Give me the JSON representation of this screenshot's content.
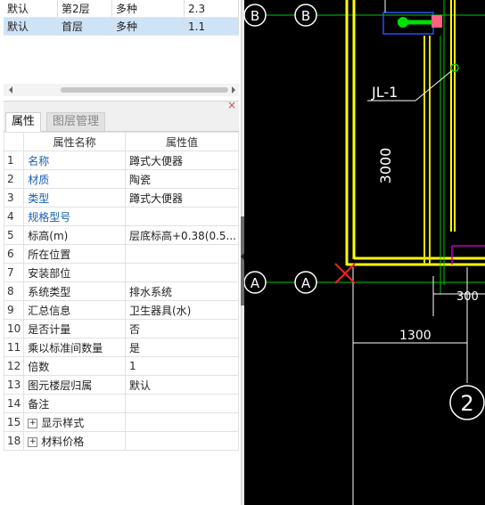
{
  "floors": [
    {
      "cells": [
        "默认",
        "第2层",
        "多种",
        "2.3"
      ],
      "selected": false
    },
    {
      "cells": [
        "默认",
        "首层",
        "多种",
        "1.1"
      ],
      "selected": true
    }
  ],
  "tabs": {
    "properties": "属性",
    "layers": "图层管理"
  },
  "props": {
    "header_name": "属性名称",
    "header_value": "属性值",
    "rows": [
      {
        "num": "1",
        "name": "名称",
        "value": "蹲式大便器",
        "blue": true
      },
      {
        "num": "2",
        "name": "材质",
        "value": "陶瓷",
        "blue": true
      },
      {
        "num": "3",
        "name": "类型",
        "value": "蹲式大便器",
        "blue": true
      },
      {
        "num": "4",
        "name": "规格型号",
        "value": "",
        "blue": true
      },
      {
        "num": "5",
        "name": "标高(m)",
        "value": "层底标高+0.38(0.5...",
        "blue": false
      },
      {
        "num": "6",
        "name": "所在位置",
        "value": "",
        "blue": false
      },
      {
        "num": "7",
        "name": "安装部位",
        "value": "",
        "blue": false
      },
      {
        "num": "8",
        "name": "系统类型",
        "value": "排水系统",
        "blue": false
      },
      {
        "num": "9",
        "name": "汇总信息",
        "value": "卫生器具(水)",
        "blue": false
      },
      {
        "num": "10",
        "name": "是否计量",
        "value": "否",
        "blue": false
      },
      {
        "num": "11",
        "name": "乘以标准间数量",
        "value": "是",
        "blue": false
      },
      {
        "num": "12",
        "name": "倍数",
        "value": "1",
        "blue": false
      },
      {
        "num": "13",
        "name": "图元楼层归属",
        "value": "默认",
        "blue": false
      },
      {
        "num": "14",
        "name": "备注",
        "value": "",
        "blue": false
      },
      {
        "num": "15",
        "name": "显示样式",
        "value": "",
        "blue": false,
        "expand": true
      },
      {
        "num": "18",
        "name": "材料价格",
        "value": "",
        "blue": false,
        "expand": true
      }
    ]
  },
  "cad": {
    "axis_b1": "B",
    "axis_b2": "B",
    "axis_a1": "A",
    "axis_a2": "A",
    "axis_2": "2",
    "pipe_label": "JL-1",
    "dim_3000": "3000",
    "dim_300": "300",
    "dim_1300": "1300"
  }
}
